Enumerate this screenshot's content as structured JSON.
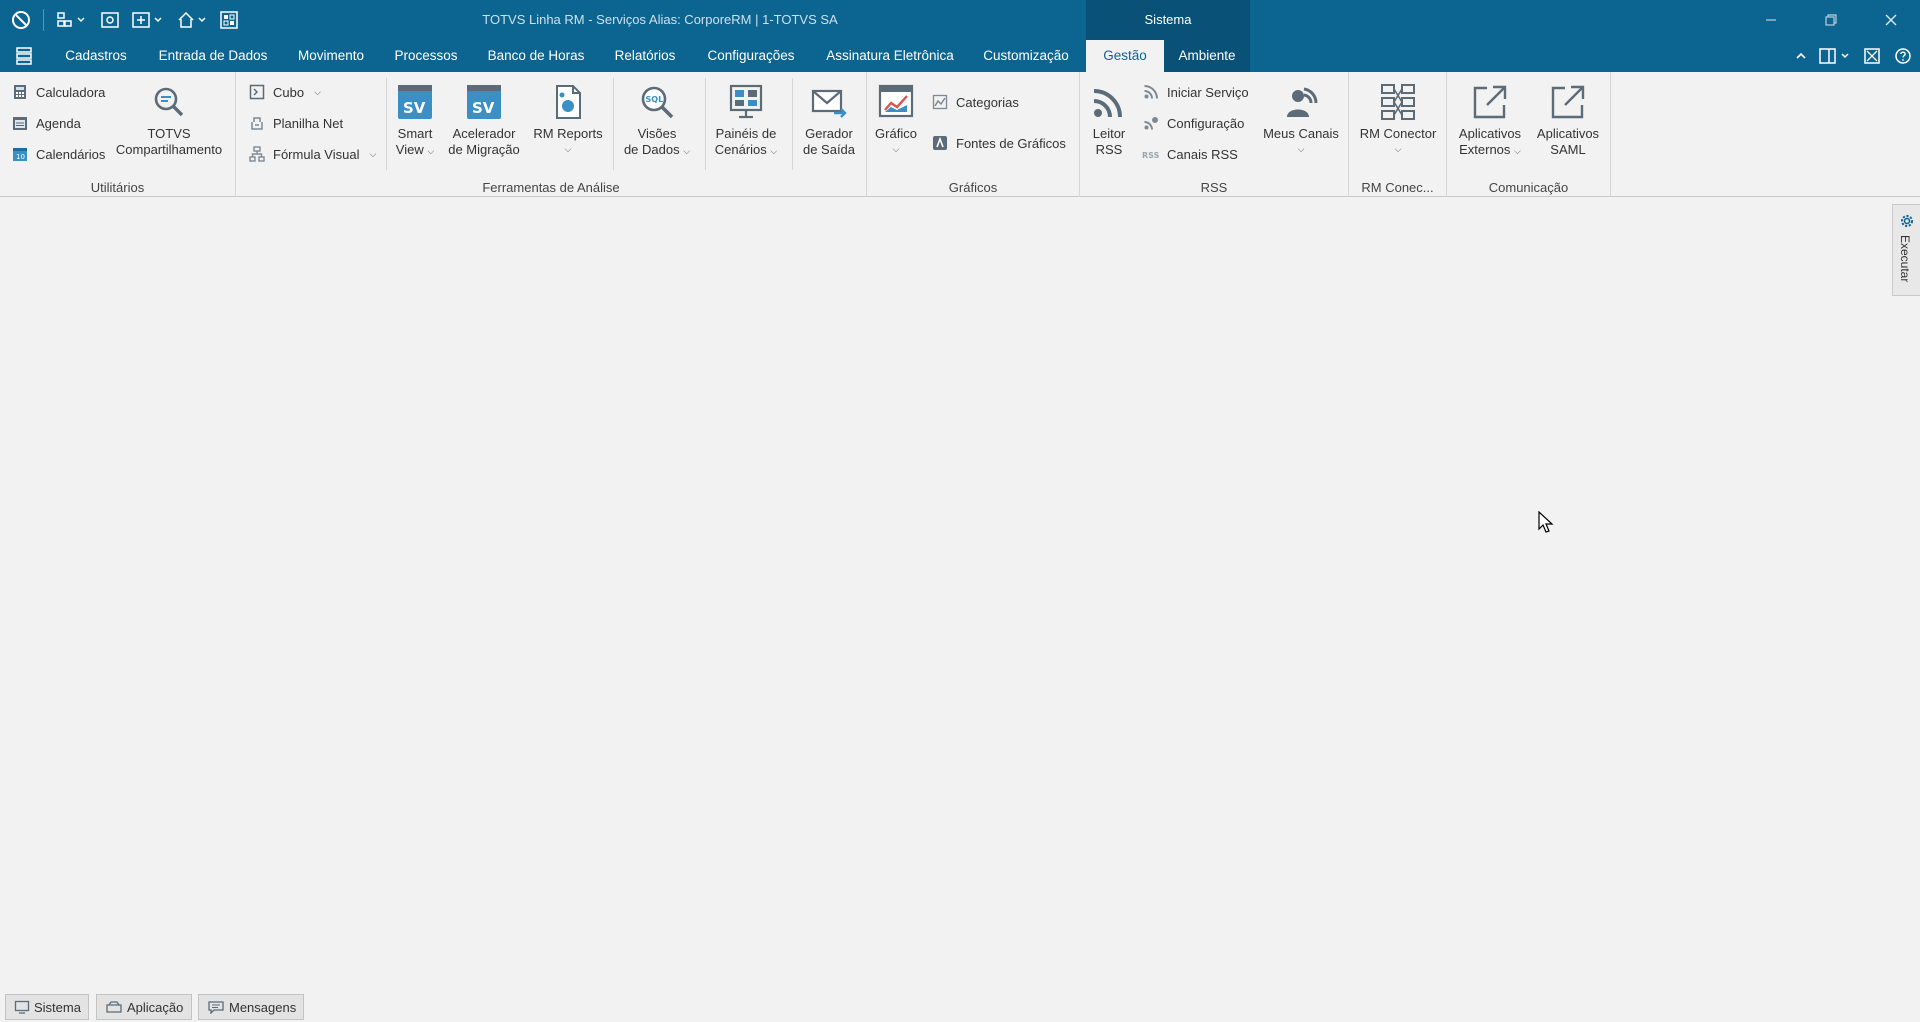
{
  "window": {
    "title": "TOTVS Linha RM - Serviços  Alias: CorporeRM | 1-TOTVS SA",
    "context_tab": "Sistema"
  },
  "menu": {
    "tabs": [
      "Cadastros",
      "Entrada de Dados",
      "Movimento",
      "Processos",
      "Banco de Horas",
      "Relatórios",
      "Configurações",
      "Assinatura Eletrônica",
      "Customização",
      "Gestão",
      "Ambiente"
    ],
    "active": "Gestão"
  },
  "ribbon": {
    "utilitarios": {
      "label": "Utilitários",
      "calculadora": "Calculadora",
      "agenda": "Agenda",
      "calendarios": "Calendários",
      "totvs_line1": "TOTVS",
      "totvs_line2": "Compartilhamento"
    },
    "analise": {
      "label": "Ferramentas de Análise",
      "cubo": "Cubo",
      "planilha": "Planilha Net",
      "formula": "Fórmula Visual",
      "smart_line1": "Smart",
      "smart_line2": "View",
      "acel_line1": "Acelerador",
      "acel_line2": "de Migração",
      "rmreports": "RM Reports",
      "visoes_line1": "Visões",
      "visoes_line2": "de Dados",
      "paineis_line1": "Painéis de",
      "paineis_line2": "Cenários",
      "gerador_line1": "Gerador",
      "gerador_line2": "de Saída",
      "sv_glyph": "SV",
      "sql_glyph": "SQL"
    },
    "graficos": {
      "label": "Gráficos",
      "grafico": "Gráfico",
      "categorias": "Categorias",
      "fontes": "Fontes de Gráficos"
    },
    "rss": {
      "label": "RSS",
      "leitor_line1": "Leitor",
      "leitor_line2": "RSS",
      "iniciar": "Iniciar Serviço",
      "configuracao": "Configuração",
      "canais": "Canais RSS",
      "meus_canais": "Meus Canais",
      "rss_glyph": "RSS"
    },
    "rmconector": {
      "label": "RM Conec...",
      "rm_conector": "RM Conector"
    },
    "comunicacao": {
      "label": "Comunicação",
      "externos_line1": "Aplicativos",
      "externos_line2": "Externos",
      "saml_line1": "Aplicativos",
      "saml_line2": "SAML"
    }
  },
  "side_panel": {
    "label": "Executar"
  },
  "bottom_tabs": [
    "Sistema",
    "Aplicação",
    "Mensagens"
  ],
  "colors": {
    "titlebar": "#0c6591",
    "accent_dark": "#0a5177",
    "background": "#f2f2f2"
  }
}
